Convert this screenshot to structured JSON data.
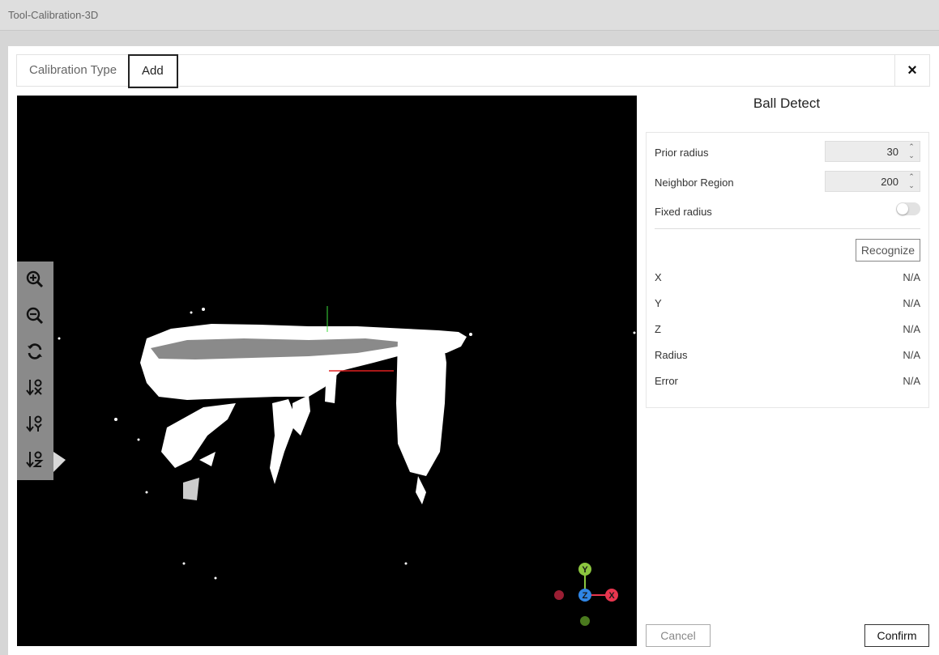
{
  "window": {
    "title": "Tool-Calibration-3D"
  },
  "tabs": [
    {
      "label": "Calibration Type"
    },
    {
      "label": "Add"
    }
  ],
  "close_label": "×",
  "panel": {
    "title": "Ball Detect",
    "prior_radius": {
      "label": "Prior radius",
      "value": "30"
    },
    "neighbor_region": {
      "label": "Neighbor Region",
      "value": "200"
    },
    "fixed_radius": {
      "label": "Fixed radius",
      "enabled": false
    },
    "recognize_label": "Recognize",
    "results": [
      {
        "label": "X",
        "value": "N/A"
      },
      {
        "label": "Y",
        "value": "N/A"
      },
      {
        "label": "Z",
        "value": "N/A"
      },
      {
        "label": "Radius",
        "value": "N/A"
      },
      {
        "label": "Error",
        "value": "N/A"
      }
    ]
  },
  "buttons": {
    "cancel": "Cancel",
    "confirm": "Confirm"
  },
  "gizmo": {
    "x_label": "X",
    "y_label": "Y",
    "z_label": "Z",
    "colors": {
      "x": "#e8364f",
      "y": "#8cc63f",
      "z": "#2f86e6"
    }
  },
  "toolbar_icons": [
    "zoom-in-icon",
    "zoom-out-icon",
    "reset-view-icon",
    "view-x-axis-icon",
    "view-y-axis-icon",
    "view-z-axis-icon"
  ]
}
